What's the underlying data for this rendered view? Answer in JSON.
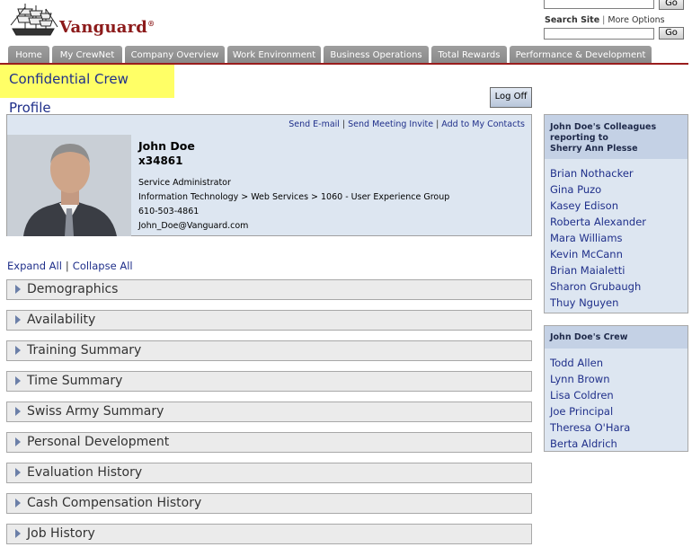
{
  "header": {
    "logo_text": "Vanguard",
    "logo_reg": "®",
    "go_top_label": "Go",
    "search_site_label": "Search Site",
    "more_options_label": "More Options",
    "go_bottom_label": "Go"
  },
  "nav": {
    "tabs": [
      {
        "label": "Home"
      },
      {
        "label": "My CrewNet"
      },
      {
        "label": "Company Overview"
      },
      {
        "label": "Work Environment"
      },
      {
        "label": "Business Operations"
      },
      {
        "label": "Total Rewards"
      },
      {
        "label": "Performance & Development"
      }
    ]
  },
  "page": {
    "title": "Confidential Crew Profile",
    "logoff_label": "Log Off"
  },
  "profile": {
    "actions": [
      "Send E-mail",
      "Send Meeting Invite",
      "Add to My Contacts"
    ],
    "name": "John Doe",
    "extension": "x34861",
    "job_title": "Service Administrator",
    "department": "Information Technology > Web Services > 1060 - User Experience Group",
    "phone": "610-503-4861",
    "email": "John_Doe@Vanguard.com"
  },
  "expand": {
    "expand_all": "Expand All",
    "collapse_all": "Collapse All"
  },
  "sections": [
    {
      "label": "Demographics"
    },
    {
      "label": "Availability"
    },
    {
      "label": "Training Summary"
    },
    {
      "label": "Time Summary"
    },
    {
      "label": "Swiss Army Summary"
    },
    {
      "label": "Personal Development"
    },
    {
      "label": "Evaluation History"
    },
    {
      "label": "Cash Compensation History"
    },
    {
      "label": "Job History"
    }
  ],
  "colleagues": {
    "heading_line1": "John Doe's Colleagues",
    "heading_line2": "reporting to",
    "heading_line3": "Sherry Ann Plesse",
    "names": [
      "Brian Nothacker",
      "Gina Puzo",
      "Kasey Edison",
      "Roberta Alexander",
      "Mara Williams",
      "Kevin McCann",
      "Brian Maialetti",
      "Sharon Grubaugh",
      "Thuy Nguyen"
    ]
  },
  "crew": {
    "heading": "John Doe's Crew",
    "names": [
      "Todd Allen",
      "Lynn Brown",
      "Lisa Coldren",
      "Joe Principal",
      "Theresa O'Hara",
      "Berta Aldrich"
    ]
  },
  "colors": {
    "nav_line": "#9a1d1d",
    "title_highlight": "#ffff66",
    "link": "#1f2f8a",
    "panel_bg": "#dde6f1"
  },
  "icons": {
    "section_arrow": "triangle-right-icon",
    "logo": "ship-icon"
  }
}
